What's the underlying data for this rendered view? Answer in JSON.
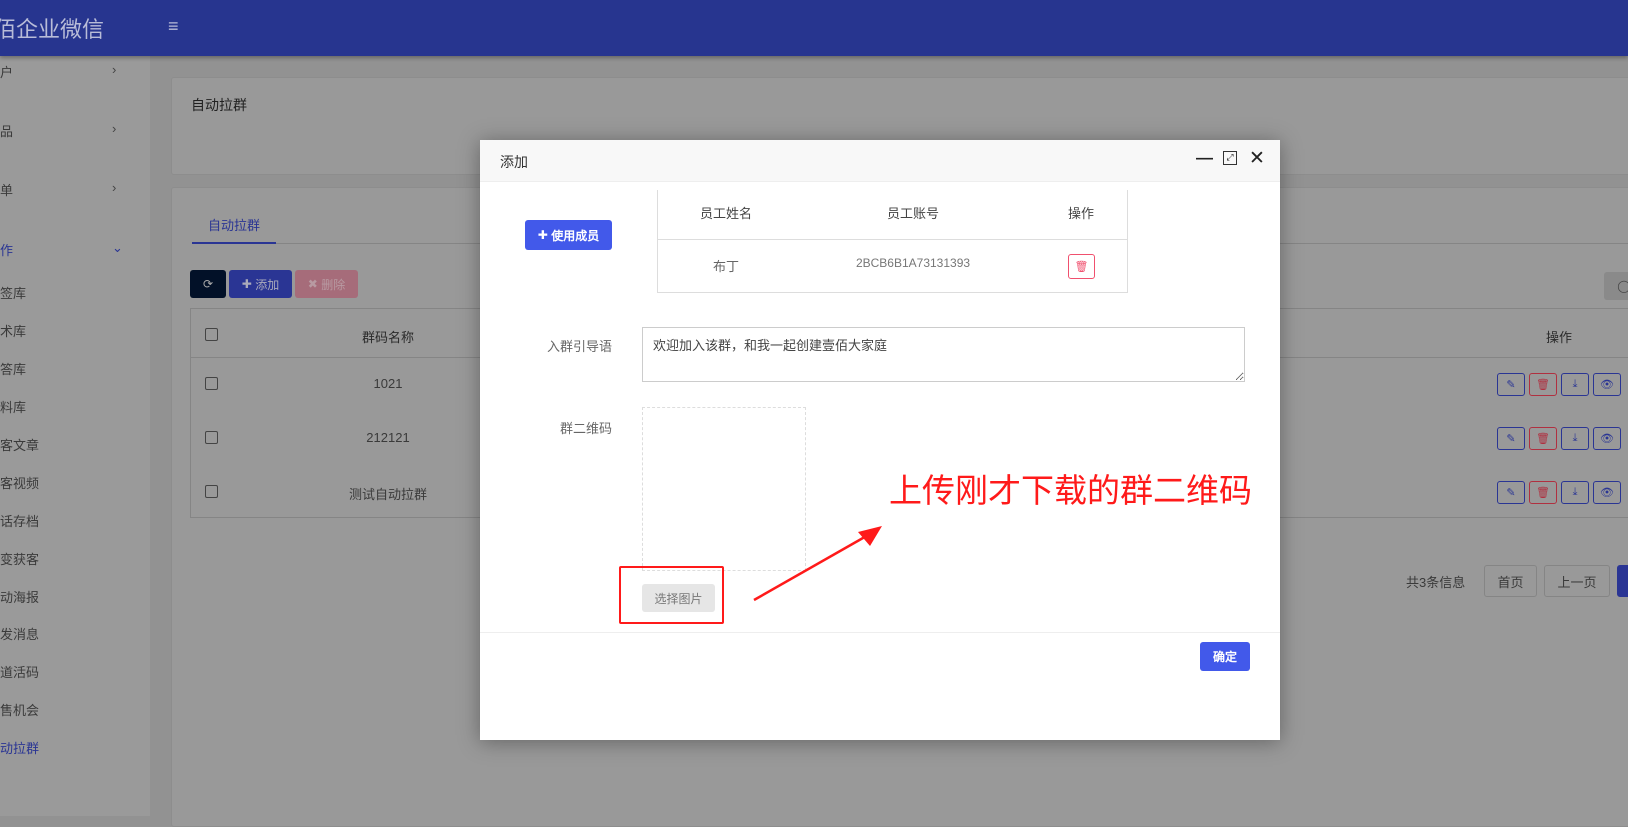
{
  "brand": "佰企业微信",
  "sidebar": {
    "items": [
      {
        "label": "户",
        "chevron": "›"
      },
      {
        "label": "品",
        "chevron": "›"
      },
      {
        "label": "单",
        "chevron": "›"
      },
      {
        "label": "作",
        "chevron": "⌄"
      },
      {
        "label": "签库"
      },
      {
        "label": "术库"
      },
      {
        "label": "答库"
      },
      {
        "label": "料库"
      },
      {
        "label": "客文章"
      },
      {
        "label": "客视频"
      },
      {
        "label": "话存档"
      },
      {
        "label": "变获客"
      },
      {
        "label": "动海报"
      },
      {
        "label": "发消息"
      },
      {
        "label": "道活码"
      },
      {
        "label": "售机会"
      },
      {
        "label": "动拉群"
      }
    ]
  },
  "page": {
    "title": "自动拉群",
    "tab": "自动拉群",
    "toolbar": {
      "add": "添加",
      "delete": "删除"
    },
    "table": {
      "headers": {
        "name": "群码名称",
        "actions": "操作"
      },
      "rows": [
        {
          "name": "1021"
        },
        {
          "name": "212121"
        },
        {
          "name": "测试自动拉群"
        }
      ]
    },
    "pagination": {
      "total": "共3条信息",
      "first": "首页",
      "prev": "上一页"
    }
  },
  "modal": {
    "title": "添加",
    "use_member": "使用成员",
    "member_table": {
      "headers": [
        "员工姓名",
        "员工账号",
        "操作"
      ],
      "rows": [
        {
          "name": "布丁",
          "account": "2BCB6B1A73131393"
        }
      ]
    },
    "guide_label": "入群引导语",
    "guide_value": "欢迎加入该群，和我一起创建壹佰大家庭",
    "qr_label": "群二维码",
    "choose_image": "选择图片",
    "confirm": "确定"
  },
  "annotation": "上传刚才下载的群二维码",
  "colors": {
    "primary": "#4259ea",
    "header": "#27358f",
    "danger": "#f0506e",
    "annotation": "#ff1a1a"
  }
}
